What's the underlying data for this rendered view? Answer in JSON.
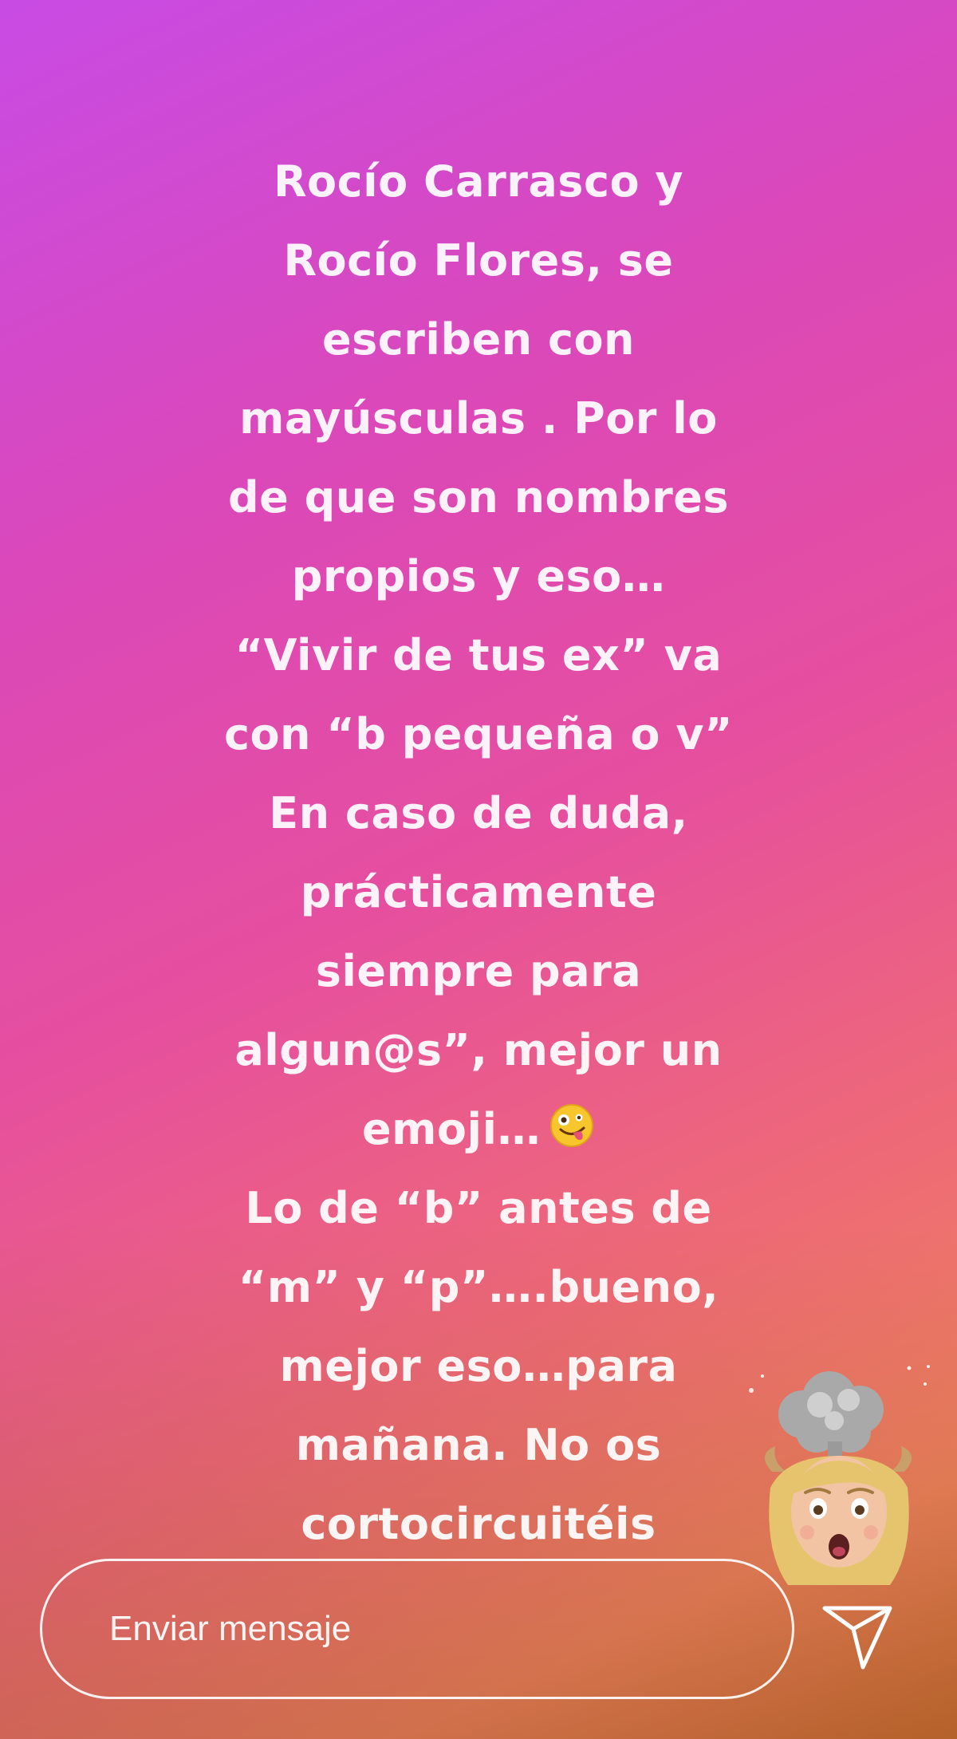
{
  "story": {
    "text_lines": [
      "Rocío Carrasco y",
      "Rocío Flores, se",
      "escriben con",
      "mayúsculas . Por lo",
      "de que son nombres",
      "propios y eso…",
      "“Vivir de tus ex” va",
      "con “b pequeña o v”",
      "En caso de duda,",
      "prácticamente",
      "siempre para",
      "algun@s”, mejor un",
      "emoji…",
      "Lo de “b” antes de",
      "“m” y “p”….bueno,",
      "mejor eso…para",
      "mañana. No os",
      "cortocircuitéis"
    ],
    "inline_emoji": "zany-face-icon",
    "sticker": "exploding-head-memoji-icon"
  },
  "reply": {
    "placeholder": "Enviar mensaje",
    "send_icon": "send-icon"
  },
  "colors": {
    "gradient_top_left": "#c84be4",
    "gradient_middle": "#e64f9e",
    "gradient_bottom_right": "#f0845c",
    "text": "#ffffff"
  }
}
